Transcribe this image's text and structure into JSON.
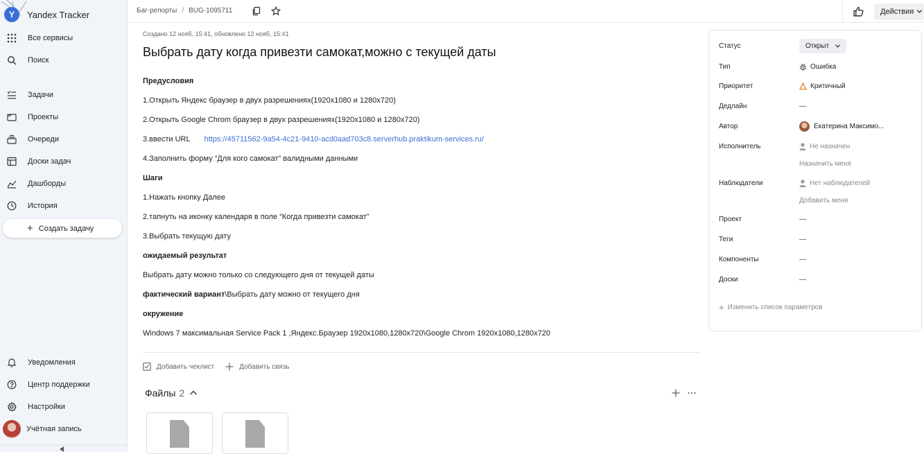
{
  "app": {
    "title": "Yandex Tracker",
    "logo_letter": "Y"
  },
  "sidebar": {
    "items": [
      {
        "label": "Все сервисы",
        "icon": "grid-icon"
      },
      {
        "label": "Поиск",
        "icon": "search-icon"
      },
      {
        "label": "Задачи",
        "icon": "tasks-icon"
      },
      {
        "label": "Проекты",
        "icon": "projects-icon"
      },
      {
        "label": "Очереди",
        "icon": "queues-icon"
      },
      {
        "label": "Доски задач",
        "icon": "boards-icon"
      },
      {
        "label": "Дашборды",
        "icon": "dashboards-icon"
      },
      {
        "label": "История",
        "icon": "history-icon"
      }
    ],
    "create_label": "Создать задачу",
    "bottom_items": [
      {
        "label": "Уведомления",
        "icon": "bell-icon"
      },
      {
        "label": "Центр поддержки",
        "icon": "help-icon"
      },
      {
        "label": "Настройки",
        "icon": "gear-icon"
      },
      {
        "label": "Учётная запись",
        "icon": "avatar"
      }
    ]
  },
  "header": {
    "breadcrumb_queue": "Баг-репорты",
    "breadcrumb_separator": "/",
    "breadcrumb_key": "BUG-1095711",
    "actions_label": "Действия"
  },
  "issue": {
    "meta": "Создано 12 нояб, 15:41, обновлено 12 нояб, 15:41",
    "title": "Выбрать дату когда привезти самокат,можно с текущей даты",
    "description": {
      "h_pre": "Предусловия",
      "pre_1": "1.Открыть Яндекс браузер в двух разрешениях(1920x1080 и 1280x720)",
      "pre_2": "2.Открыть Google Chrom браузер в двух разрешениях(1920x1080 и 1280x720)",
      "pre_3": "3.ввести URL",
      "pre_3_link": "https://45711562-9a54-4c21-9410-acd0aad703c8.serverhub.praktikum-services.ru/",
      "pre_4": "4.Заполнить форму “Для кого самокат” валидными данными",
      "h_steps": "Шаги",
      "step_1": "1.Нажать кнопку Далее",
      "step_2": "2.тапнуть на иконку календаря в поле “Когда привезти самокат”",
      "step_3": "3.Выбрать текущую дату",
      "h_expected": "ожидаемый результат",
      "expected": "Выбрать дату можно только со следующего дня от текущей даты",
      "h_actual": "фактический вариант",
      "actual": "\\Выбрать дату можно от текущего дня",
      "h_env": "окружение",
      "env": "Windows 7 максимальная Service Pack 1 ,Яндекс.Браузер 1920x1080,1280x720\\Google Chrom 1920x1080,1280x720"
    },
    "add_checklist": "Добавить чеклист",
    "add_link": "Добавить связь",
    "files_label": "Файлы",
    "files_count": "2"
  },
  "panel": {
    "status_label": "Статус",
    "status_value": "Открыт",
    "type_label": "Тип",
    "type_value": "Ошибка",
    "priority_label": "Приоритет",
    "priority_value": "Критичный",
    "deadline_label": "Дедлайн",
    "deadline_value": "—",
    "author_label": "Автор",
    "author_value": "Екатерина Максимо...",
    "assignee_label": "Исполнитель",
    "assignee_value": "Не назначен",
    "assign_me": "Назначить меня",
    "followers_label": "Наблюдатели",
    "followers_value": "Нет наблюдателей",
    "add_me": "Добавить меня",
    "project_label": "Проект",
    "project_value": "—",
    "tags_label": "Теги",
    "tags_value": "—",
    "components_label": "Компоненты",
    "components_value": "—",
    "boards_label": "Доски",
    "boards_value": "—",
    "change_params": "Изменить список параметров"
  },
  "colors": {
    "link": "#3d6fd6",
    "priority": "#e07a1f",
    "sidebar_bg": "#f1f4f9",
    "logo": "#3a6fd8"
  }
}
